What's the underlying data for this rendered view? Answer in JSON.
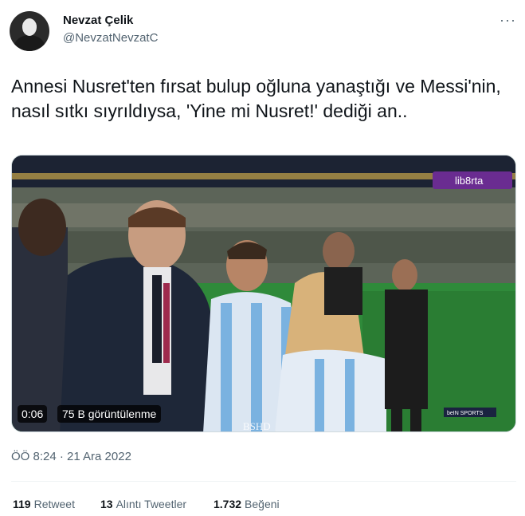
{
  "author": {
    "display_name": "Nevzat Çelik",
    "handle": "@NevzatNevzatC"
  },
  "more_menu": {
    "label": "···"
  },
  "tweet": {
    "text": "Annesi Nusret'ten fırsat bulup oğluna yanaştığı ve Messi'nin, nasıl sıtkı sıyrıldıysa, 'Yine mi Nusret!' dediği an.."
  },
  "media": {
    "duration": "0:06",
    "views": "75 B görüntülenme",
    "channel_logo": "lib8rta",
    "watermark": "BSHD",
    "scoreboard_logo": "beIN SPORTS"
  },
  "meta": {
    "timestamp": "ÖÖ 8:24 · 21 Ara 2022"
  },
  "stats": {
    "retweets_count": "119",
    "retweets_label": "Retweet",
    "quotes_count": "13",
    "quotes_label": "Alıntı Tweetler",
    "likes_count": "1.732",
    "likes_label": "Beğeni"
  },
  "colors": {
    "text_primary": "#0f1419",
    "text_secondary": "#536471",
    "divider": "#eff3f4"
  }
}
